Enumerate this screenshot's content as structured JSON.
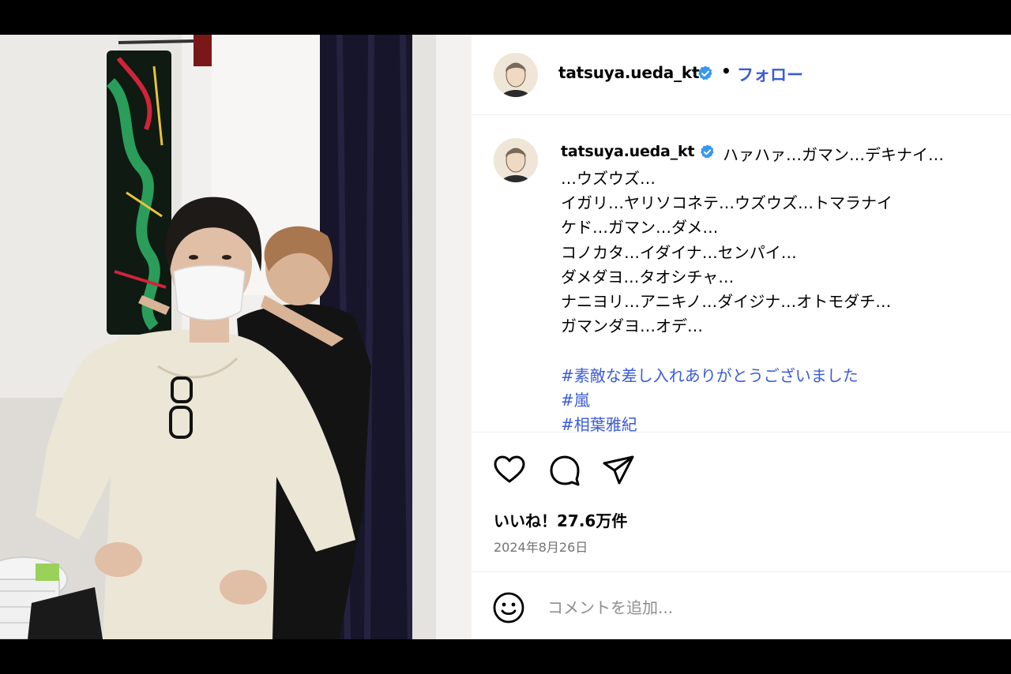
{
  "post": {
    "username": "tatsuya.ueda_kt",
    "separator": "•",
    "follow_label": "フォロー",
    "caption_first_line": "ハァハァ…ガマン…デキナイ…",
    "caption_lines": [
      "…ウズウズ…",
      "イガリ…ヤリソコネテ…ウズウズ…トマラナイ",
      "ケド…ガマン…ダメ…",
      "コノカタ…イダイナ…センパイ…",
      "ダメダヨ…タオシチャ…",
      "ナニヨリ…アニキノ…ダイジナ…オトモダチ…",
      "ガマンダヨ…オデ…"
    ],
    "hashtags": [
      "#素敵な差し入れありがとうございました",
      "#嵐",
      "#相葉雅紀"
    ],
    "likes": "いいね！27.6万件",
    "date": "2024年8月26日",
    "comment_placeholder": "コメントを追加..."
  },
  "icons": {
    "verified": "verified-badge-icon",
    "like": "heart-icon",
    "comment": "speech-bubble-icon",
    "share": "paper-plane-icon",
    "emoji": "smiley-icon"
  },
  "colors": {
    "link": "#3b5bdb",
    "verified": "#3797f0",
    "muted": "#737373",
    "divider": "#efefef"
  }
}
